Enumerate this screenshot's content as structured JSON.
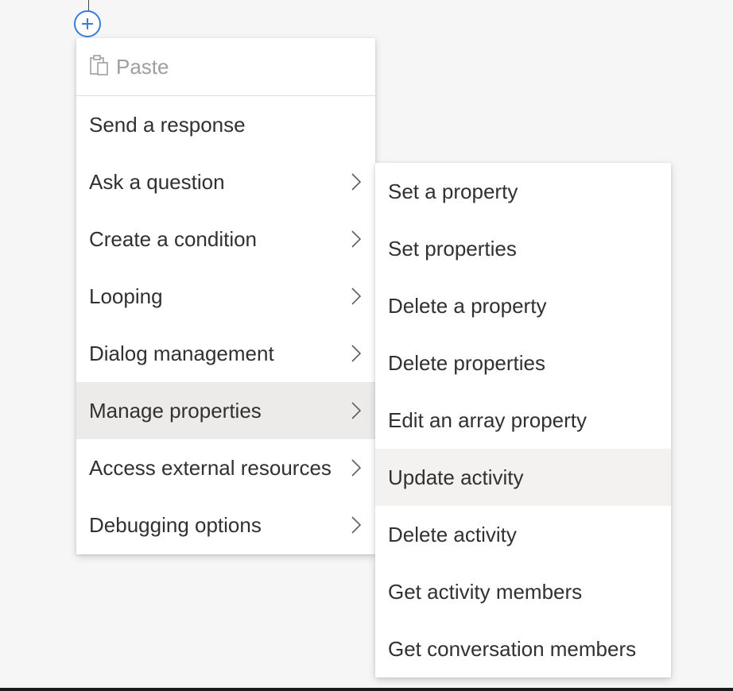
{
  "colors": {
    "canvas_background": "#f6f6f6",
    "menu_background": "#ffffff",
    "accent_blue": "#3e7bd6",
    "text": "#323130",
    "disabled_text": "#a19f9d",
    "hover_main": "#edebe9",
    "hover_sub": "#f3f2f1"
  },
  "canvas": {
    "add_button_icon": "plus-icon"
  },
  "main_menu": {
    "paste": {
      "label": "Paste",
      "icon": "clipboard-icon",
      "disabled": true
    },
    "items": [
      {
        "label": "Send a response",
        "has_submenu": false
      },
      {
        "label": "Ask a question",
        "has_submenu": true
      },
      {
        "label": "Create a condition",
        "has_submenu": true
      },
      {
        "label": "Looping",
        "has_submenu": true
      },
      {
        "label": "Dialog management",
        "has_submenu": true
      },
      {
        "label": "Manage properties",
        "has_submenu": true,
        "highlighted": true
      },
      {
        "label": "Access external resources",
        "has_submenu": true
      },
      {
        "label": "Debugging options",
        "has_submenu": true
      }
    ],
    "chevron_icon": "chevron-right-icon"
  },
  "sub_menu": {
    "parent": "Manage properties",
    "items": [
      {
        "label": "Set a property"
      },
      {
        "label": "Set properties"
      },
      {
        "label": "Delete a property"
      },
      {
        "label": "Delete properties"
      },
      {
        "label": "Edit an array property"
      },
      {
        "label": "Update activity",
        "highlighted": true
      },
      {
        "label": "Delete activity"
      },
      {
        "label": "Get activity members"
      },
      {
        "label": "Get conversation members"
      }
    ]
  }
}
